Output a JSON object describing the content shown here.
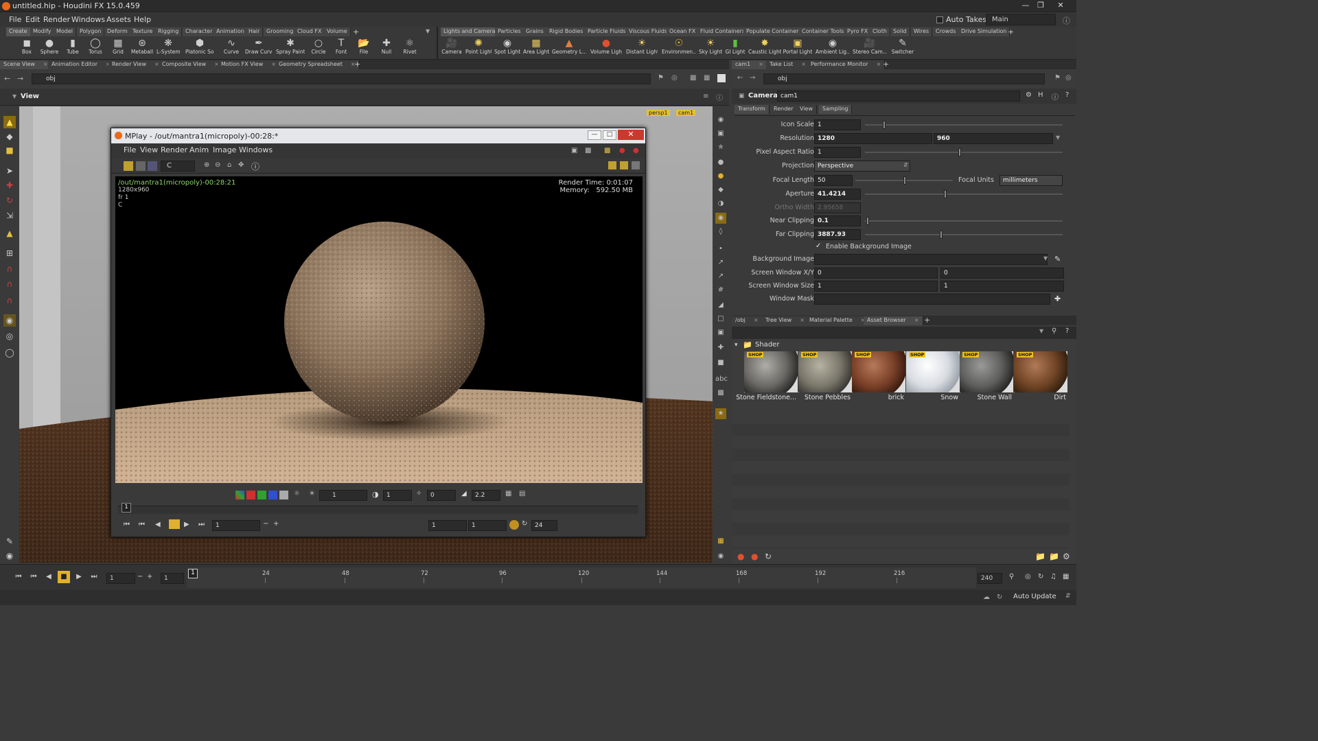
{
  "window": {
    "title": "untitled.hip - Houdini FX 15.0.459"
  },
  "menubar": {
    "items": [
      "File",
      "Edit",
      "Render",
      "Windows",
      "Assets",
      "Help"
    ],
    "auto_takes": "Auto Takes",
    "desktop": "Main"
  },
  "shelf_left": {
    "tabs": [
      "Create",
      "Modify",
      "Model",
      "Polygon",
      "Deform",
      "Texture",
      "Rigging",
      "Character",
      "Animation",
      "Hair",
      "Grooming",
      "Cloud FX",
      "Volume"
    ],
    "tools": [
      "Box",
      "Sphere",
      "Tube",
      "Torus",
      "Grid",
      "Metaball",
      "L-System",
      "Platonic Sol...",
      "Curve",
      "Draw Curve",
      "Spray Paint",
      "Circle",
      "Font",
      "File",
      "Null",
      "Rivet"
    ]
  },
  "shelf_right": {
    "tabs": [
      "Lights and Cameras",
      "Particles",
      "Grains",
      "Rigid Bodies",
      "Particle Fluids",
      "Viscous Fluids",
      "Ocean FX",
      "Fluid Containers",
      "Populate Containers",
      "Container Tools",
      "Pyro FX",
      "Cloth",
      "Solid",
      "Wires",
      "Crowds",
      "Drive Simulation"
    ],
    "tools": [
      "Camera",
      "Point Light",
      "Spot Light",
      "Area Light",
      "Geometry L...",
      "Volume Light",
      "Distant Light",
      "Environmen...",
      "Sky Light",
      "GI Light",
      "Caustic Light",
      "Portal Light",
      "Ambient Lig...",
      "Stereo Cam...",
      "Switcher"
    ]
  },
  "left_pane": {
    "tabs": [
      "Scene View",
      "Animation Editor",
      "Render View",
      "Composite View",
      "Motion FX View",
      "Geometry Spreadsheet"
    ],
    "path": "obj",
    "view_label": "View",
    "cam_badges": [
      "persp1",
      "cam1"
    ]
  },
  "mplay": {
    "title": "MPlay - /out/mantra1(micropoly)-00:28:*",
    "menu": [
      "File",
      "View",
      "Render",
      "Anim",
      "Image",
      "Windows"
    ],
    "channel": "C",
    "info_name": "/out/mantra1(micropoly)-00:28:21",
    "info_res": "1280x960",
    "info_frame": "fr 1",
    "info_channel": "C",
    "render_time": "Render Time: 0:01:07",
    "memory": "Memory:   592.50 MB",
    "exposure": "1",
    "gamma_field": "1",
    "offset": "0",
    "gamma": "2.2",
    "frame_marker": "1",
    "frame_field": "1",
    "range_start": "1",
    "range_end": "1",
    "fps": "24"
  },
  "right_top": {
    "tabs": [
      "cam1",
      "Take List",
      "Performance Monitor"
    ],
    "path": "obj",
    "node_type": "Camera",
    "node_name": "cam1",
    "param_tabs": [
      "Transform",
      "Render",
      "View",
      "Sampling"
    ],
    "params": {
      "icon_scale": {
        "label": "Icon Scale",
        "value": "1"
      },
      "resolution": {
        "label": "Resolution",
        "x": "1280",
        "y": "960"
      },
      "pixel_aspect": {
        "label": "Pixel Aspect Ratio",
        "value": "1"
      },
      "projection": {
        "label": "Projection",
        "value": "Perspective"
      },
      "focal_length": {
        "label": "Focal Length",
        "value": "50",
        "units_label": "Focal Units",
        "units": "millimeters"
      },
      "aperture": {
        "label": "Aperture",
        "value": "41.4214"
      },
      "ortho_width": {
        "label": "Ortho Width",
        "value": "2.95658"
      },
      "near_clip": {
        "label": "Near Clipping",
        "value": "0.1"
      },
      "far_clip": {
        "label": "Far Clipping",
        "value": "3887.93"
      },
      "enable_bg": {
        "label": "Enable Background Image"
      },
      "bg_image": {
        "label": "Background Image",
        "value": ""
      },
      "screen_window_xy": {
        "label": "Screen Window X/Y",
        "x": "0",
        "y": "0"
      },
      "screen_window_size": {
        "label": "Screen Window Size",
        "x": "1",
        "y": "1"
      },
      "window_mask": {
        "label": "Window Mask",
        "value": ""
      }
    }
  },
  "right_bottom": {
    "tabs": [
      "/obj",
      "Tree View",
      "Material Palette",
      "Asset Browser"
    ],
    "folder": "Shader",
    "shop_badge": "SHOP",
    "assets": [
      "Stone Fieldstone...",
      "Stone Pebbles",
      "brick",
      "Snow",
      "Stone Wall",
      "Dirt"
    ]
  },
  "timeline": {
    "current_frame": "1",
    "start_frame": "1",
    "ticks": [
      "24",
      "48",
      "72",
      "96",
      "120",
      "144",
      "168",
      "192",
      "216"
    ],
    "marker": "1",
    "end_frame": "240"
  },
  "status": {
    "auto_update": "Auto Update"
  }
}
